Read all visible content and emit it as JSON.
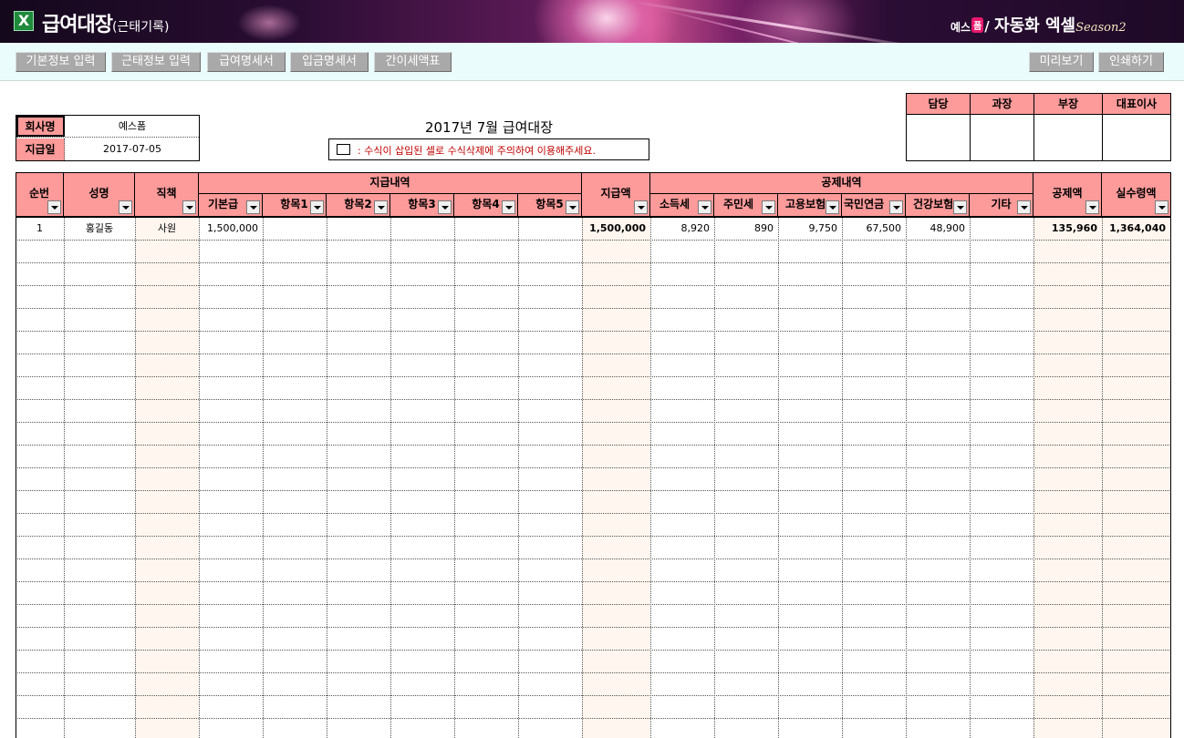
{
  "app": {
    "title": "급여대장",
    "subtitle": "(근태기록)",
    "excel_glyph": "X",
    "brand_a": "예스",
    "brand_badge": "폼",
    "brand_b": "/",
    "brand_c": "자동화 엑셀",
    "brand_season": "Season2"
  },
  "toolbar": {
    "buttons": [
      "기본정보 입력",
      "근태정보 입력",
      "급여명세서",
      "입금명세서",
      "간이세액표"
    ],
    "right_buttons": [
      "미리보기",
      "인쇄하기"
    ]
  },
  "info": {
    "company_label": "회사명",
    "company_value": "예스폼",
    "paydate_label": "지급일",
    "paydate_value": "2017-07-05"
  },
  "doc": {
    "title": "2017년  7월  급여대장",
    "notice": ": 수식이 삽입된 셀로 수식삭제에 주의하여 이용해주세요."
  },
  "approval": [
    "담당",
    "과장",
    "부장",
    "대표이사"
  ],
  "table": {
    "headers": {
      "no": "순번",
      "name": "성명",
      "position": "직책",
      "pay_group": "지급내역",
      "pay_items": [
        "기본급",
        "항목1",
        "항목2",
        "항목3",
        "항목4",
        "항목5"
      ],
      "pay_total": "지급액",
      "deduct_group": "공제내역",
      "deduct_items": [
        "소득세",
        "주민세",
        "고용보험",
        "국민연금",
        "건강보험",
        "기타"
      ],
      "deduct_total": "공제액",
      "net": "실수령액"
    },
    "rows": [
      {
        "no": "1",
        "name": "홍길동",
        "position": "사원",
        "base": "1,500,000",
        "item1": "",
        "item2": "",
        "item3": "",
        "item4": "",
        "item5": "",
        "pay_total": "1,500,000",
        "income_tax": "8,920",
        "resident_tax": "890",
        "employment_ins": "9,750",
        "pension": "67,500",
        "health_ins": "48,900",
        "other": "",
        "deduct_total": "135,960",
        "net": "1,364,040"
      }
    ]
  },
  "colors": {
    "header_fill": "#fd9a9a",
    "button_fill": "#a9a9a9",
    "toolbar_bg": "#ebfcfc",
    "notice_text": "#c00000",
    "row_shade": "#fff6ef"
  }
}
